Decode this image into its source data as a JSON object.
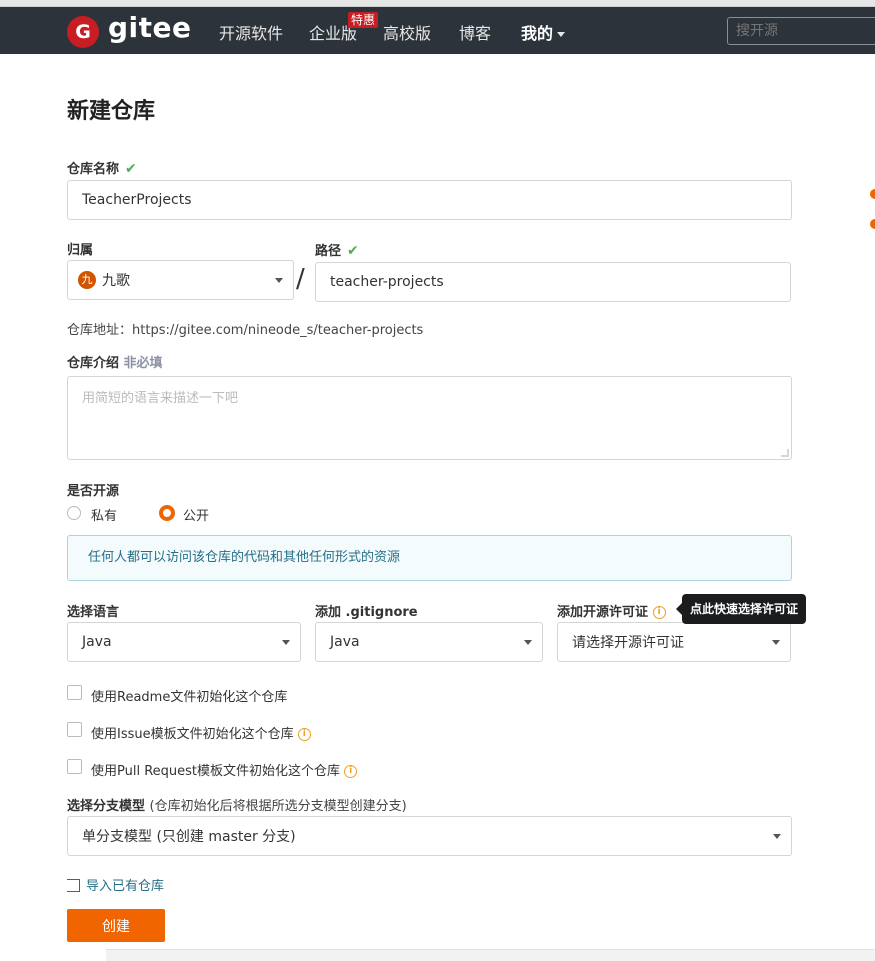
{
  "nav": {
    "logo_badge": "G",
    "logo_text": "gitee",
    "items": [
      "开源软件",
      "企业版",
      "高校版",
      "博客",
      "我的"
    ],
    "badge": "特惠",
    "search_placeholder": "搜开源"
  },
  "page_title": "新建仓库",
  "repo_name": {
    "label": "仓库名称",
    "value": "TeacherProjects"
  },
  "owner": {
    "label": "归属",
    "avatar_char": "九",
    "value": "九歌"
  },
  "path": {
    "label": "路径",
    "value": "teacher-projects",
    "separator": "/"
  },
  "repo_url": {
    "label": "仓库地址：",
    "value": "https://gitee.com/nineode_s/teacher-projects"
  },
  "intro": {
    "label": "仓库介绍",
    "optional": "非必填",
    "placeholder": "用简短的语言来描述一下吧"
  },
  "visibility": {
    "label": "是否开源",
    "options": [
      "私有",
      "公开"
    ],
    "selected": "公开",
    "info": "任何人都可以访问该仓库的代码和其他任何形式的资源"
  },
  "language": {
    "label": "选择语言",
    "value": "Java"
  },
  "gitignore": {
    "label": "添加 .gitignore",
    "value": "Java"
  },
  "license": {
    "label": "添加开源许可证",
    "value": "请选择开源许可证",
    "tooltip": "点此快速选择许可证"
  },
  "checkboxes": [
    "使用Readme文件初始化这个仓库",
    "使用Issue模板文件初始化这个仓库",
    "使用Pull Request模板文件初始化这个仓库"
  ],
  "branch": {
    "label": "选择分支模型",
    "hint": "(仓库初始化后将根据所选分支模型创建分支)",
    "value": "单分支模型 (只创建 master 分支)"
  },
  "import_link": "导入已有仓库",
  "create_button": "创建",
  "icons": {
    "check": "check-icon",
    "info": "info-icon",
    "caret": "chevron-down-icon",
    "import": "import-icon"
  },
  "colors": {
    "nav_bg": "#2d333b",
    "brand_red": "#c71d23",
    "accent_orange": "#f06500",
    "success_green": "#4caf50",
    "info_text": "#276f86"
  }
}
